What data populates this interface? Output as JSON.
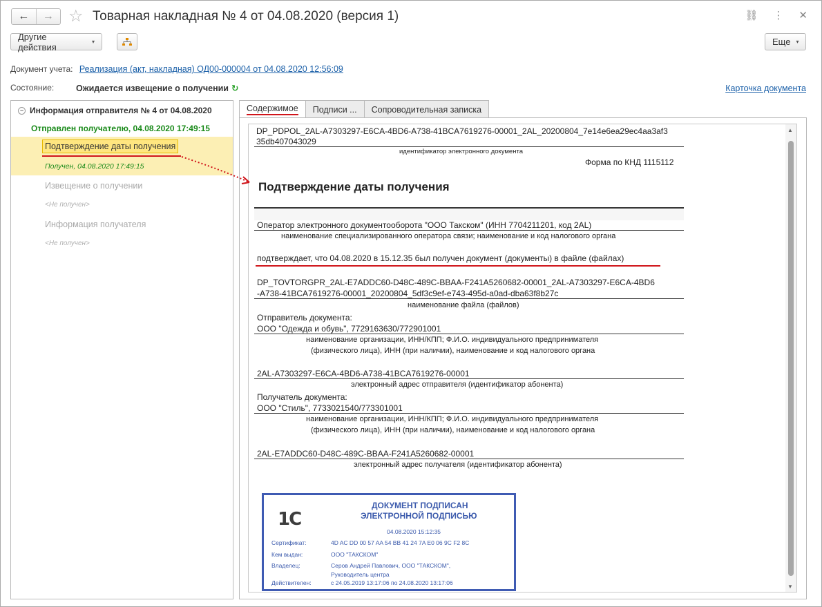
{
  "window": {
    "title": "Товарная накладная № 4 от 04.08.2020 (версия 1)",
    "nav_back": "←",
    "nav_forward": "→",
    "star": "☆",
    "icon_link": "⛓",
    "icon_menu": "⋮",
    "icon_close": "✕"
  },
  "toolbar": {
    "other_actions": "Другие действия",
    "more": "Еще",
    "caret": "▾",
    "structure_icon": "⁂"
  },
  "doc_row": {
    "label": "Документ учета:",
    "link": "Реализация (акт, накладная) ОД00-000004 от 04.08.2020 12:56:09"
  },
  "state_row": {
    "label": "Состояние:",
    "value": "Ожидается извещение о получении",
    "refresh_icon": "↻"
  },
  "card_link": "Карточка документа",
  "tree": {
    "minus": "−",
    "header": "Информация отправителя № 4 от 04.08.2020",
    "sent": "Отправлен получателю, 04.08.2020 17:49:15",
    "confirm": "Подтверждение даты получения",
    "received": "Получен, 04.08.2020 17:49:15",
    "notice": "Извещение о получении",
    "not_received_1": "<Не получен>",
    "info": "Информация получателя",
    "not_received_2": "<Не получен>"
  },
  "tabs": [
    "Содержимое",
    "Подписи ...",
    "Сопроводительная записка"
  ],
  "document": {
    "id_line1": "DP_PDPOL_2AL-A7303297-E6CA-4BD6-A738-41BCA7619276-00001_2AL_20200804_7e14e6ea29ec4aa3af3",
    "id_line2": "35db407043029",
    "id_caption": "идентификатор электронного документа",
    "knd": "Форма по КНД 1115112",
    "heading": "Подтверждение даты получения",
    "operator": "Оператор электронного документооборота \"ООО Такском\" (ИНН 7704211201, код 2AL)",
    "operator_caption": "наименование специализированного оператора связи; наименование и код налогового органа",
    "confirms": "подтверждает, что 04.08.2020 в 15.12.35 был получен документ  (документы) в файле (файлах)",
    "file_line1": "DP_TOVTORGPR_2AL-E7ADDC60-D48C-489C-BBAA-F241A5260682-00001_2AL-A7303297-E6CA-4BD6",
    "file_line2": "-A738-41BCA7619276-00001_20200804_5df3c9ef-e743-495d-a0ad-dba63f8b27c",
    "file_caption": "наименование файла (файлов)",
    "sender_label": "Отправитель документа:",
    "sender_value": "ООО \"Одежда и обувь\", 7729163630/772901001",
    "sender_caption1": "наименование организации, ИНН/КПП; Ф.И.О. индивидуального предпринимателя",
    "sender_caption2": "(физического лица), ИНН (при наличии), наименование и код налогового органа",
    "sender_address": "2AL-A7303297-E6CA-4BD6-A738-41BCA7619276-00001",
    "sender_address_caption": "электронный адрес отправителя (идентификатор абонента)",
    "recipient_label": "Получатель документа:",
    "recipient_value": "ООО \"Стиль\", 7733021540/773301001",
    "recipient_caption1": "наименование организации, ИНН/КПП; Ф.И.О. индивидуального предпринимателя",
    "recipient_caption2": "(физического лица), ИНН (при наличии), наименование и код налогового органа",
    "recipient_address": "2AL-E7ADDC60-D48C-489C-BBAA-F241A5260682-00001",
    "recipient_address_caption": "электронный адрес получателя (идентификатор абонента)"
  },
  "stamp": {
    "logo": "1С",
    "title1": "ДОКУМЕНТ ПОДПИСАН",
    "title2": "ЭЛЕКТРОННОЙ ПОДПИСЬЮ",
    "date": "04.08.2020 15:12:35",
    "cert_label": "Сертификат:",
    "cert_value": "4D AC DD 00 57 AA 54 BB 41 24 7A E0 06 9C F2 8C",
    "issuer_label": "Кем выдан:",
    "issuer_value": "ООО \"ТАКСКОМ\"",
    "owner_label": "Владелец:",
    "owner_value1": "Серов Андрей Павлович, ООО \"ТАКСКОМ\",",
    "owner_value2": "Руководитель центра",
    "valid_label": "Действителен:",
    "valid_value": "с 24.05.2019 13:17:06 по 24.08.2020 13:17:06"
  },
  "scroll": {
    "up": "▲",
    "down": "▼"
  },
  "colors": {
    "accent_red": "#d0141a",
    "link_blue": "#1a5fa8",
    "green": "#1a8a1a",
    "stamp_blue": "#3f5bb3",
    "selection": "#fcefb4"
  }
}
